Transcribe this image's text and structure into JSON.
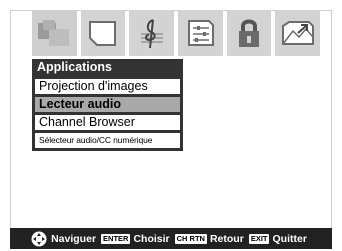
{
  "tabs": [
    {
      "icon": "picture-icon"
    },
    {
      "icon": "screen-icon"
    },
    {
      "icon": "music-clef-icon"
    },
    {
      "icon": "equalizer-icon"
    },
    {
      "icon": "lock-icon"
    },
    {
      "icon": "applications-icon"
    }
  ],
  "menu": {
    "title": "Applications",
    "items": [
      {
        "label": "Projection d'images"
      },
      {
        "label": "Lecteur audio"
      },
      {
        "label": "Channel Browser"
      },
      {
        "label": "Sélecteur audio/CC numérique"
      }
    ]
  },
  "footer": {
    "navigate": "Naviguer",
    "enter_key": "ENTER",
    "choose": "Choisir",
    "ch_rtn_key": "CH RTN",
    "back": "Retour",
    "exit_key": "EXIT",
    "quit": "Quitter"
  },
  "colors": {
    "menu_bg": "#333333",
    "selected_item": "#a9a9a9",
    "tab_bg": "#d3d3d3",
    "footer_bg": "#222222"
  }
}
